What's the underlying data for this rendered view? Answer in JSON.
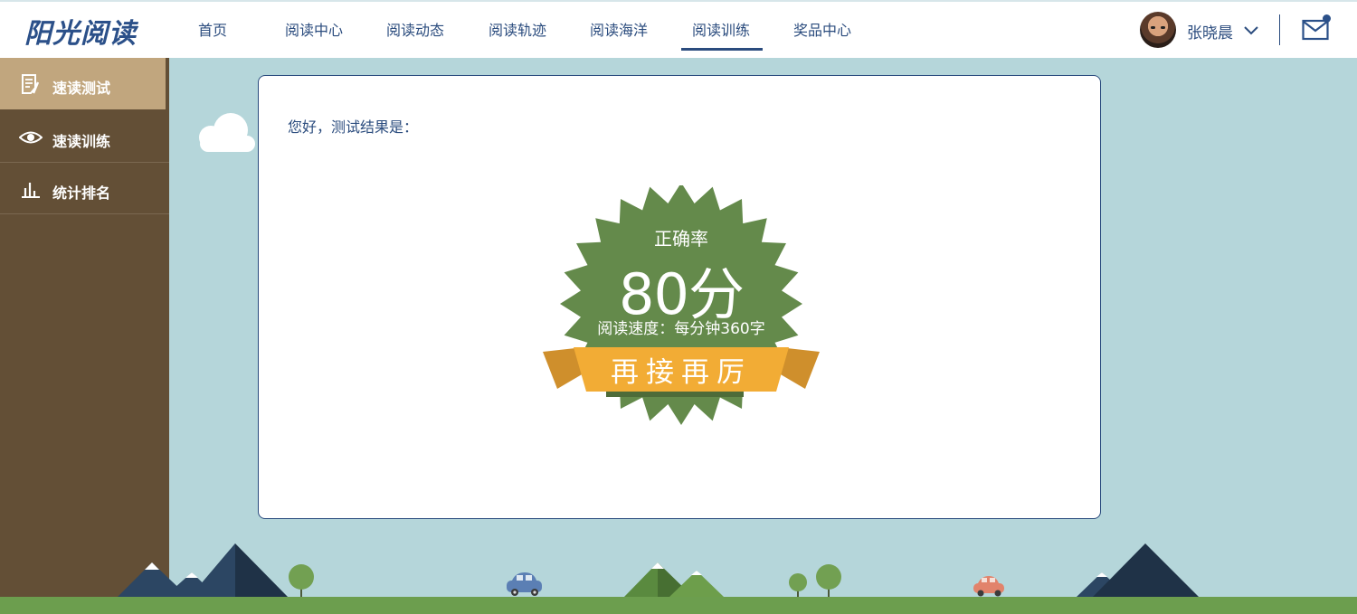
{
  "app": {
    "logo": "阳光阅读"
  },
  "nav": {
    "items": [
      {
        "label": "首页"
      },
      {
        "label": "阅读中心"
      },
      {
        "label": "阅读动态"
      },
      {
        "label": "阅读轨迹"
      },
      {
        "label": "阅读海洋"
      },
      {
        "label": "阅读训练",
        "active": true
      },
      {
        "label": "奖品中心"
      }
    ]
  },
  "user": {
    "name": "张晓晨",
    "avatar_icon": "user-avatar",
    "mail_icon": "mail-icon",
    "has_notification": true
  },
  "sidebar": {
    "items": [
      {
        "label": "速读测试",
        "icon": "document-edit-icon",
        "active": true
      },
      {
        "label": "速读训练",
        "icon": "eye-icon"
      },
      {
        "label": "统计排名",
        "icon": "bar-chart-icon"
      }
    ]
  },
  "result": {
    "greeting": "您好，测试结果是：",
    "accuracy_label": "正确率",
    "score": "80分",
    "speed": "阅读速度：每分钟360字",
    "motto": "再接再厉"
  },
  "colors": {
    "brand": "#2b5089",
    "sidebar": "#634f36",
    "sidebar_active": "#c1a67e",
    "badge_green": "#648a4b",
    "ribbon_orange": "#f2ac35",
    "background": "#b5d6da"
  }
}
